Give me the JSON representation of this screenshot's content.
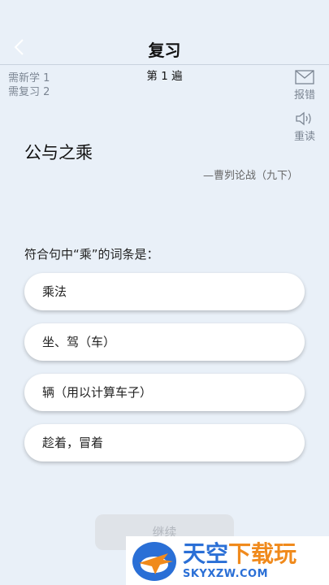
{
  "header": {
    "title": "复习",
    "round": "第 1 遍"
  },
  "stats": {
    "new_label": "需新学",
    "new_count": "1",
    "review_label": "需复习",
    "review_count": "2"
  },
  "actions": {
    "report_label": "报错",
    "reread_label": "重读"
  },
  "card": {
    "word": "公与之乘",
    "source": "—曹刿论战（九下）",
    "question": "符合句中“乘”的词条是："
  },
  "options": [
    "乘法",
    "坐、驾（车）",
    "辆（用以计算车子）",
    "趁着，冒着"
  ],
  "continue_label": "继续",
  "watermark": {
    "title_a": "天空",
    "title_b": "下载玩",
    "url": "SKYXZW.COM"
  }
}
